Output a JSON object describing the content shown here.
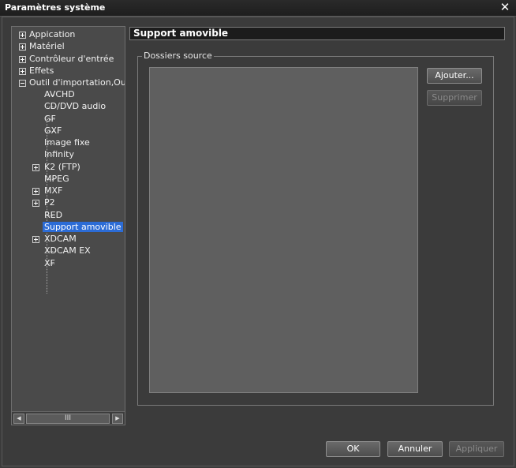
{
  "window": {
    "title": "Paramètres système",
    "close_glyph": "✕"
  },
  "tree": {
    "items": [
      {
        "label": "Appication",
        "expander": "plus"
      },
      {
        "label": "Matériel",
        "expander": "plus"
      },
      {
        "label": "Contrôleur d'entrée",
        "expander": "plus"
      },
      {
        "label": "Effets",
        "expander": "plus"
      },
      {
        "label": "Outil d'importation,Outil d'",
        "expander": "minus"
      },
      {
        "label": "AVCHD"
      },
      {
        "label": "CD/DVD audio"
      },
      {
        "label": "GF"
      },
      {
        "label": "GXF"
      },
      {
        "label": "Image fixe"
      },
      {
        "label": "Infinity"
      },
      {
        "label": "K2 (FTP)",
        "expander": "plus"
      },
      {
        "label": "MPEG"
      },
      {
        "label": "MXF",
        "expander": "plus"
      },
      {
        "label": "P2",
        "expander": "plus"
      },
      {
        "label": "RED"
      },
      {
        "label": "Support amovible",
        "selected": true
      },
      {
        "label": "XDCAM",
        "expander": "plus"
      },
      {
        "label": "XDCAM EX"
      },
      {
        "label": "XF"
      }
    ],
    "scroll_thumb_glyph": "III"
  },
  "panel": {
    "header": "Support amovible",
    "group_label": "Dossiers source",
    "add_button": "Ajouter...",
    "remove_button": "Supprimer"
  },
  "footer": {
    "ok": "OK",
    "cancel": "Annuler",
    "apply": "Appliquer"
  },
  "colors": {
    "selection": "#2c6cd6",
    "background": "#3b3b3b"
  }
}
